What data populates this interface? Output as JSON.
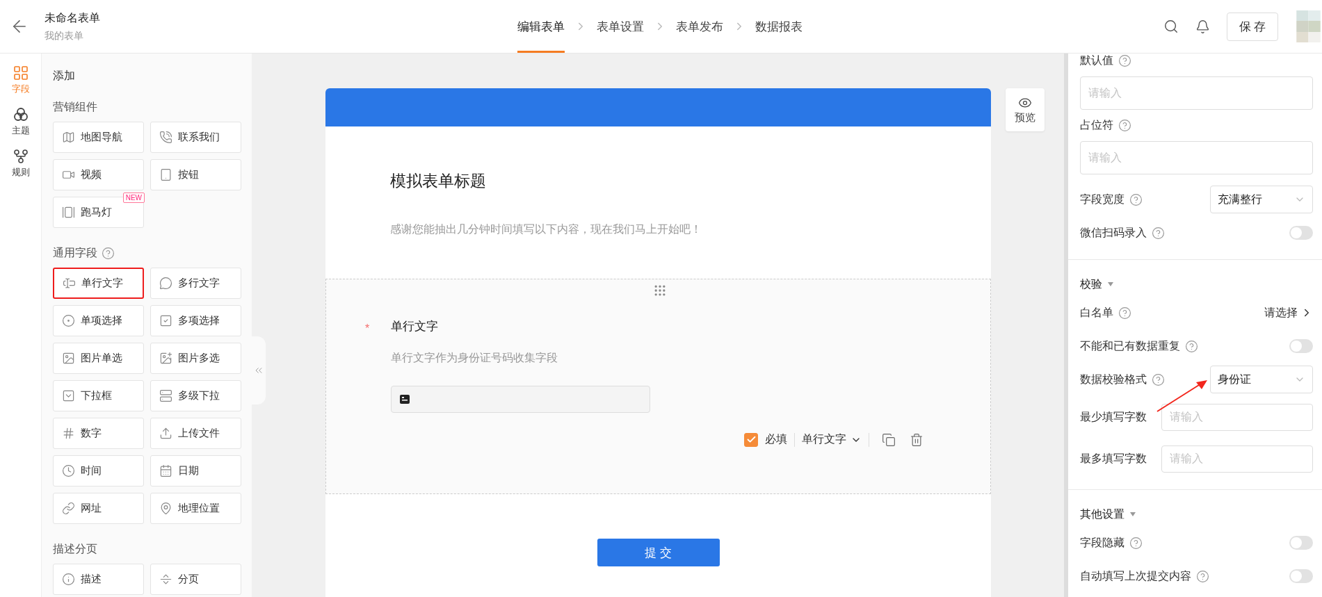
{
  "header": {
    "title": "未命名表单",
    "subtitle": "我的表单",
    "steps": [
      {
        "label": "编辑表单",
        "selected": true
      },
      {
        "label": "表单设置",
        "selected": false
      },
      {
        "label": "表单发布",
        "selected": false
      },
      {
        "label": "数据报表",
        "selected": false
      }
    ],
    "save": "保 存"
  },
  "rail": [
    {
      "label": "字段",
      "selected": true
    },
    {
      "label": "主题",
      "selected": false
    },
    {
      "label": "规则",
      "selected": false
    }
  ],
  "palette": {
    "title": "添加",
    "sections": [
      {
        "title": "营销组件",
        "help": false,
        "items": [
          {
            "label": "地图导航",
            "selected": false
          },
          {
            "label": "联系我们",
            "selected": false
          },
          {
            "label": "视频",
            "selected": false
          },
          {
            "label": "按钮",
            "selected": false
          },
          {
            "label": "跑马灯",
            "badge": "NEW",
            "selected": false
          }
        ]
      },
      {
        "title": "通用字段",
        "help": true,
        "items": [
          {
            "label": "单行文字",
            "selected": true
          },
          {
            "label": "多行文字",
            "selected": false
          },
          {
            "label": "单项选择",
            "selected": false
          },
          {
            "label": "多项选择",
            "selected": false
          },
          {
            "label": "图片单选",
            "selected": false
          },
          {
            "label": "图片多选",
            "selected": false
          },
          {
            "label": "下拉框",
            "selected": false
          },
          {
            "label": "多级下拉",
            "selected": false
          },
          {
            "label": "数字",
            "selected": false
          },
          {
            "label": "上传文件",
            "selected": false
          },
          {
            "label": "时间",
            "selected": false
          },
          {
            "label": "日期",
            "selected": false
          },
          {
            "label": "网址",
            "selected": false
          },
          {
            "label": "地理位置",
            "selected": false
          }
        ]
      },
      {
        "title": "描述分页",
        "help": false,
        "items": [
          {
            "label": "描述",
            "selected": false
          },
          {
            "label": "分页",
            "selected": false
          }
        ]
      }
    ]
  },
  "form": {
    "title": "模拟表单标题",
    "description": "感谢您能抽出几分钟时间填写以下内容，现在我们马上开始吧！",
    "field": {
      "label": "单行文字",
      "required_mark": "*",
      "description": "单行文字作为身份证号码收集字段",
      "required_label": "必填",
      "required_checked": true,
      "type_label": "单行文字"
    },
    "submit": "提 交"
  },
  "preview": "预览",
  "settings": [
    {
      "rows": [
        {
          "kind": "input",
          "label": "默认值",
          "help": true,
          "placeholder": "请输入"
        },
        {
          "kind": "input",
          "label": "占位符",
          "help": true,
          "placeholder": "请输入"
        },
        {
          "kind": "select",
          "label": "字段宽度",
          "help": true,
          "value": "充满整行"
        },
        {
          "kind": "toggle",
          "label": "微信扫码录入",
          "help": true,
          "on": false
        }
      ]
    },
    {
      "title": "校验",
      "rows": [
        {
          "kind": "link",
          "label": "白名单",
          "help": true,
          "value": "请选择"
        },
        {
          "kind": "toggle",
          "label": "不能和已有数据重复",
          "help": true,
          "on": false
        },
        {
          "kind": "select",
          "label": "数据校验格式",
          "help": true,
          "value": "身份证"
        },
        {
          "kind": "inline",
          "label": "最少填写字数",
          "help": false,
          "placeholder": "请输入"
        },
        {
          "kind": "inline",
          "label": "最多填写字数",
          "help": false,
          "placeholder": "请输入"
        }
      ]
    },
    {
      "title": "其他设置",
      "rows": [
        {
          "kind": "toggle",
          "label": "字段隐藏",
          "help": true,
          "on": false
        },
        {
          "kind": "toggle",
          "label": "自动填写上次提交内容",
          "help": true,
          "on": false
        }
      ]
    }
  ]
}
